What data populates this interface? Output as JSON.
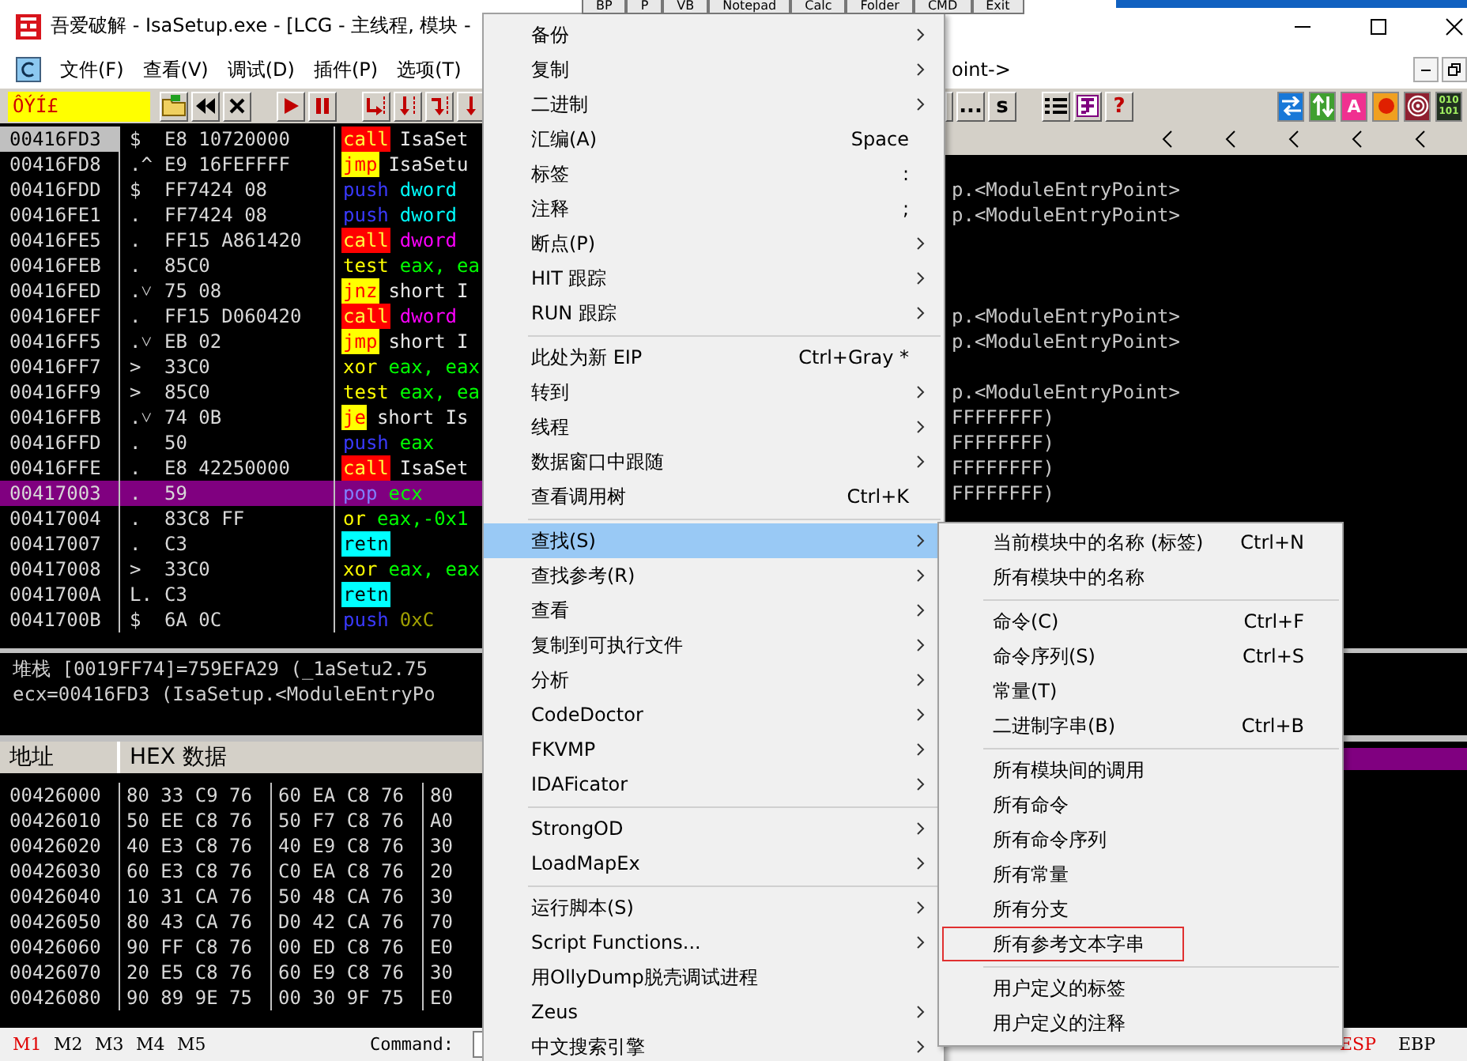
{
  "top_buttons": [
    "BP",
    "P",
    "VB",
    "Notepad",
    "Calc",
    "Folder",
    "CMD",
    "Exit"
  ],
  "window": {
    "title": "吾爱破解 - IsaSetup.exe - [LCG - 主线程, 模块 -"
  },
  "menu_bar": [
    "文件(F)",
    "查看(V)",
    "调试(D)",
    "插件(P)",
    "选项(T)"
  ],
  "child_title": "oint->",
  "toolbar": {
    "status_field": "ÔÝÍ£",
    "text_buttons": [
      "...",
      "s"
    ],
    "help": "?",
    "letter_badge": "A",
    "binary_badge": [
      "010",
      "101"
    ]
  },
  "disassembly": {
    "rows": [
      {
        "address": "00416FD3",
        "mark": "$",
        "hex": "E8 10720000",
        "instruction": {
          "kind": "call",
          "text": "call"
        },
        "operand": {
          "kind": "label",
          "text": "IsaSet"
        },
        "selected": false,
        "eip": true
      },
      {
        "address": "00416FD8",
        "mark": ".^",
        "hex": "E9 16FEFFFF",
        "instruction": {
          "kind": "jump",
          "text": "jmp"
        },
        "operand": {
          "kind": "label",
          "text": "IsaSetu"
        },
        "selected": false,
        "eip": false
      },
      {
        "address": "00416FDD",
        "mark": "$",
        "hex": "FF7424 08",
        "instruction": {
          "kind": "stack",
          "text": "push"
        },
        "operand": {
          "kind": "mem",
          "text": "dword"
        },
        "selected": false,
        "eip": false,
        "comment": "p.<ModuleEntryPoint>"
      },
      {
        "address": "00416FE1",
        "mark": ".",
        "hex": "FF7424 08",
        "instruction": {
          "kind": "stack",
          "text": "push"
        },
        "operand": {
          "kind": "mem",
          "text": "dword"
        },
        "selected": false,
        "eip": false,
        "comment": "p.<ModuleEntryPoint>"
      },
      {
        "address": "00416FE5",
        "mark": ".",
        "hex": "FF15 A861420",
        "instruction": {
          "kind": "call",
          "text": "call"
        },
        "operand": {
          "kind": "callmem",
          "text": "dword"
        },
        "selected": false,
        "eip": false
      },
      {
        "address": "00416FEB",
        "mark": ".",
        "hex": "85C0",
        "instruction": {
          "kind": "plain",
          "text": "test"
        },
        "operand": {
          "kind": "reg",
          "text": "eax, ea"
        },
        "selected": false,
        "eip": false
      },
      {
        "address": "00416FED",
        "mark": ".˅",
        "hex": "75 08",
        "instruction": {
          "kind": "jump",
          "text": "jnz"
        },
        "operand": {
          "kind": "label",
          "text": "short I"
        },
        "selected": false,
        "eip": false
      },
      {
        "address": "00416FEF",
        "mark": ".",
        "hex": "FF15 D060420",
        "instruction": {
          "kind": "call",
          "text": "call"
        },
        "operand": {
          "kind": "callmem",
          "text": "dword"
        },
        "selected": false,
        "eip": false,
        "comment": "p.<ModuleEntryPoint>"
      },
      {
        "address": "00416FF5",
        "mark": ".˅",
        "hex": "EB 02",
        "instruction": {
          "kind": "jump",
          "text": "jmp"
        },
        "operand": {
          "kind": "label",
          "text": "short I"
        },
        "selected": false,
        "eip": false,
        "comment": "p.<ModuleEntryPoint>"
      },
      {
        "address": "00416FF7",
        "mark": ">",
        "hex": "33C0",
        "instruction": {
          "kind": "plain",
          "text": "xor"
        },
        "operand": {
          "kind": "reg",
          "text": "eax, eax"
        },
        "selected": false,
        "eip": false
      },
      {
        "address": "00416FF9",
        "mark": ">",
        "hex": "85C0",
        "instruction": {
          "kind": "plain",
          "text": "test"
        },
        "operand": {
          "kind": "reg",
          "text": "eax, ea"
        },
        "selected": false,
        "eip": false,
        "comment": "p.<ModuleEntryPoint>"
      },
      {
        "address": "00416FFB",
        "mark": ".˅",
        "hex": "74 0B",
        "instruction": {
          "kind": "jump",
          "text": "je"
        },
        "operand": {
          "kind": "label",
          "text": "short Is"
        },
        "selected": false,
        "eip": false,
        "comment": "FFFFFFFF)"
      },
      {
        "address": "00416FFD",
        "mark": ".",
        "hex": "50",
        "instruction": {
          "kind": "stack",
          "text": "push"
        },
        "operand": {
          "kind": "reg",
          "text": "eax"
        },
        "selected": false,
        "eip": false,
        "comment": "FFFFFFFF)"
      },
      {
        "address": "00416FFE",
        "mark": ".",
        "hex": "E8 42250000",
        "instruction": {
          "kind": "call",
          "text": "call"
        },
        "operand": {
          "kind": "label",
          "text": "IsaSet"
        },
        "selected": false,
        "eip": false,
        "comment": "FFFFFFFF)"
      },
      {
        "address": "00417003",
        "mark": ".",
        "hex": "59",
        "instruction": {
          "kind": "stack",
          "text": "pop"
        },
        "operand": {
          "kind": "reg",
          "text": "ecx"
        },
        "selected": true,
        "eip": false,
        "comment": "FFFFFFFF)"
      },
      {
        "address": "00417004",
        "mark": ".",
        "hex": "83C8 FF",
        "instruction": {
          "kind": "plain",
          "text": "or"
        },
        "operand": {
          "kind": "reg",
          "text": "eax,-0x1"
        },
        "selected": false,
        "eip": false
      },
      {
        "address": "00417007",
        "mark": ".",
        "hex": "C3",
        "instruction": {
          "kind": "ret",
          "text": "retn"
        },
        "selected": false,
        "eip": false
      },
      {
        "address": "00417008",
        "mark": ">",
        "hex": "33C0",
        "instruction": {
          "kind": "plain",
          "text": "xor"
        },
        "operand": {
          "kind": "reg",
          "text": "eax, eax"
        },
        "selected": false,
        "eip": false
      },
      {
        "address": "0041700A",
        "mark": "L.",
        "hex": "C3",
        "instruction": {
          "kind": "ret",
          "text": "retn"
        },
        "selected": false,
        "eip": false
      },
      {
        "address": "0041700B",
        "mark": "$",
        "hex": "6A 0C",
        "instruction": {
          "kind": "stack",
          "text": "push"
        },
        "operand": {
          "kind": "imm",
          "text": "0xC"
        },
        "selected": false,
        "eip": false
      }
    ]
  },
  "info": [
    "堆栈 [0019FF74]=759EFA29 (_1aSetu2.75",
    "ecx=00416FD3 (IsaSetup.<ModuleEntryPo"
  ],
  "dump": {
    "columns": [
      "地址",
      "HEX 数据"
    ],
    "rows": [
      {
        "address": "00426000",
        "groups": [
          "80 33 C9 76",
          "60 EA C8 76",
          "80"
        ]
      },
      {
        "address": "00426010",
        "groups": [
          "50 EE C8 76",
          "50 F7 C8 76",
          "A0"
        ]
      },
      {
        "address": "00426020",
        "groups": [
          "40 E3 C8 76",
          "40 E9 C8 76",
          "30"
        ]
      },
      {
        "address": "00426030",
        "groups": [
          "60 E3 C8 76",
          "C0 EA C8 76",
          "20"
        ]
      },
      {
        "address": "00426040",
        "groups": [
          "10 31 CA 76",
          "50 48 CA 76",
          "30"
        ]
      },
      {
        "address": "00426050",
        "groups": [
          "80 43 CA 76",
          "D0 42 CA 76",
          "70"
        ]
      },
      {
        "address": "00426060",
        "groups": [
          "90 FF C8 76",
          "00 ED C8 76",
          "E0"
        ]
      },
      {
        "address": "00426070",
        "groups": [
          "20 E5 C8 76",
          "60 E9 C8 76",
          "30"
        ]
      },
      {
        "address": "00426080",
        "groups": [
          "90 89 9E 75",
          "00 30 9F 75",
          "E0"
        ]
      }
    ]
  },
  "status_bar": {
    "markers": [
      {
        "label": "M1",
        "active": true
      },
      {
        "label": "M2",
        "active": false
      },
      {
        "label": "M3",
        "active": false
      },
      {
        "label": "M4",
        "active": false
      },
      {
        "label": "M5",
        "active": false
      }
    ],
    "command_label": "Command:",
    "registers": [
      {
        "label": "ESP",
        "highlighted": true
      },
      {
        "label": "EBP",
        "highlighted": false
      }
    ]
  },
  "context_menu": {
    "groups": [
      [
        {
          "label": "备份",
          "submenu": true,
          "selected": false
        },
        {
          "label": "复制",
          "submenu": true,
          "selected": false
        },
        {
          "label": "二进制",
          "submenu": true,
          "selected": false
        },
        {
          "label": "汇编(A)",
          "shortcut": "Space",
          "submenu": false,
          "selected": false
        },
        {
          "label": "标签",
          "shortcut": ":",
          "submenu": false,
          "selected": false
        },
        {
          "label": "注释",
          "shortcut": ";",
          "submenu": false,
          "selected": false
        },
        {
          "label": "断点(P)",
          "submenu": true,
          "selected": false
        },
        {
          "label": "HIT 跟踪",
          "submenu": true,
          "selected": false
        },
        {
          "label": "RUN 跟踪",
          "submenu": true,
          "selected": false
        }
      ],
      [
        {
          "label": "此处为新 EIP",
          "shortcut": "Ctrl+Gray *",
          "submenu": false,
          "selected": false
        },
        {
          "label": "转到",
          "submenu": true,
          "selected": false
        },
        {
          "label": "线程",
          "submenu": true,
          "selected": false
        },
        {
          "label": "数据窗口中跟随",
          "submenu": true,
          "selected": false
        },
        {
          "label": "查看调用树",
          "shortcut": "Ctrl+K",
          "submenu": false,
          "selected": false
        }
      ],
      [
        {
          "label": "查找(S)",
          "submenu": true,
          "selected": true
        },
        {
          "label": "查找参考(R)",
          "submenu": true,
          "selected": false
        },
        {
          "label": "查看",
          "submenu": true,
          "selected": false
        },
        {
          "label": "复制到可执行文件",
          "submenu": true,
          "selected": false
        },
        {
          "label": "分析",
          "submenu": true,
          "selected": false
        },
        {
          "label": "CodeDoctor",
          "submenu": true,
          "selected": false
        },
        {
          "label": "FKVMP",
          "submenu": true,
          "selected": false
        },
        {
          "label": "IDAFicator",
          "submenu": true,
          "selected": false
        }
      ],
      [
        {
          "label": "StrongOD",
          "submenu": true,
          "selected": false
        },
        {
          "label": "LoadMapEx",
          "submenu": true,
          "selected": false
        }
      ],
      [
        {
          "label": "运行脚本(S)",
          "submenu": true,
          "selected": false
        },
        {
          "label": "Script Functions...",
          "submenu": true,
          "selected": false
        },
        {
          "label": "用OllyDump脱壳调试进程",
          "submenu": false,
          "selected": false
        },
        {
          "label": "Zeus",
          "submenu": true,
          "selected": false
        },
        {
          "label": "中文搜索引擎",
          "submenu": true,
          "selected": false
        }
      ]
    ]
  },
  "submenu": {
    "groups": [
      [
        {
          "label": "当前模块中的名称 (标签)",
          "shortcut": "Ctrl+N",
          "outlined": false
        },
        {
          "label": "所有模块中的名称",
          "outlined": false
        }
      ],
      [
        {
          "label": "命令(C)",
          "shortcut": "Ctrl+F",
          "outlined": false
        },
        {
          "label": "命令序列(S)",
          "shortcut": "Ctrl+S",
          "outlined": false
        },
        {
          "label": "常量(T)",
          "outlined": false
        },
        {
          "label": "二进制字串(B)",
          "shortcut": "Ctrl+B",
          "outlined": false
        }
      ],
      [
        {
          "label": "所有模块间的调用",
          "outlined": false
        },
        {
          "label": "所有命令",
          "outlined": false
        },
        {
          "label": "所有命令序列",
          "outlined": false
        },
        {
          "label": "所有常量",
          "outlined": false
        },
        {
          "label": "所有分支",
          "outlined": false
        },
        {
          "label": "所有参考文本字串",
          "outlined": true
        }
      ],
      [
        {
          "label": "用户定义的标签",
          "outlined": false
        },
        {
          "label": "用户定义的注释",
          "outlined": false
        }
      ]
    ]
  }
}
